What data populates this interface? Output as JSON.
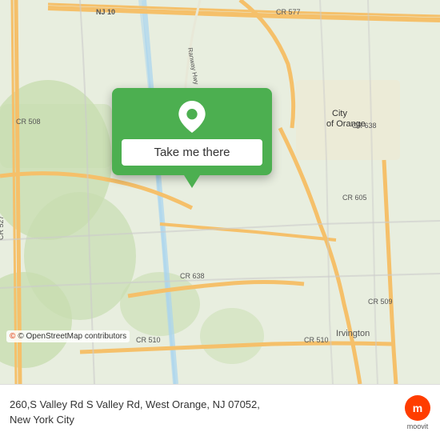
{
  "map": {
    "background_color": "#e8eedf",
    "attribution": "© OpenStreetMap contributors"
  },
  "popup": {
    "button_label": "Take me there",
    "pin_color": "#ffffff"
  },
  "bottom_bar": {
    "address": "260,S Valley Rd S Valley Rd, West Orange, NJ 07052,",
    "city": "New York City",
    "osm_attribution": "© OpenStreetMap contributors",
    "moovit_label": "moovit"
  }
}
